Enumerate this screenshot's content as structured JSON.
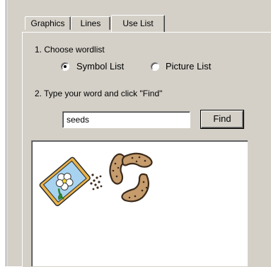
{
  "tabs": [
    {
      "label": "Graphics",
      "active": false
    },
    {
      "label": "Lines",
      "active": false
    },
    {
      "label": "Use List",
      "active": true
    }
  ],
  "step1": {
    "heading": "1. Choose wordlist",
    "options": [
      {
        "label": "Symbol List",
        "selected": true
      },
      {
        "label": "Picture List",
        "selected": false
      }
    ]
  },
  "step2": {
    "heading": "2. Type your word and click \"Find\"",
    "search_value": "seeds",
    "find_label": "Find"
  },
  "results": {
    "items": [
      {
        "icon": "seed-packet-icon"
      },
      {
        "icon": "seeds-icon"
      }
    ]
  },
  "colors": {
    "face": "#d4d0c8",
    "packet": "#a7d3f0",
    "packet_border": "#e9b34a",
    "seed_fill": "#c69c6d",
    "seed_outline": "#3b2a1a"
  }
}
